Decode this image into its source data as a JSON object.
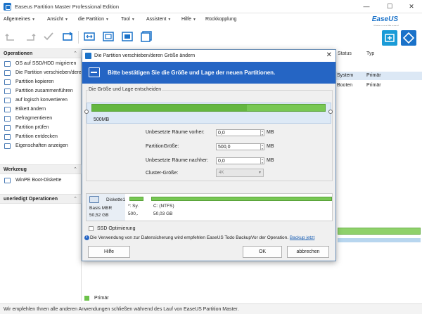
{
  "window": {
    "title": "Easeus Partition Master Professional Edition",
    "minimize": "—",
    "maximize": "☐",
    "close": "✕"
  },
  "menu": [
    {
      "label": "Allgemeines"
    },
    {
      "label": "Ansicht"
    },
    {
      "label": "die Partition"
    },
    {
      "label": "Tool"
    },
    {
      "label": "Assistent"
    },
    {
      "label": "Hilfe"
    },
    {
      "label": "Rückkopplung"
    }
  ],
  "logo": {
    "text": "EaseUS",
    "sub": "Make your life easy!"
  },
  "sidebar": {
    "operations_title": "Operationen",
    "operations": [
      "OS auf SSD/HDD migrieren",
      "Die Partition verschieben/deren Größe ändern",
      "Partition kopieren",
      "Partition zusammenführen",
      "auf logisch konvertieren",
      "Etikett ändern",
      "Defragmentieren",
      "Partition prüfen",
      "Partition entdecken",
      "Eigenschaften anzeigen"
    ],
    "tools_title": "Werkzeug",
    "tools": [
      "WinPE Boot-Diskette"
    ],
    "pending_title": "unerledigt Operationen",
    "collapse": "⌃"
  },
  "main": {
    "columns": {
      "status": "Status",
      "type": "Typ"
    },
    "rows": [
      {
        "status": "System",
        "type": "Primär"
      },
      {
        "status": "Booten",
        "type": "Primär"
      }
    ],
    "legend_label": "Primär"
  },
  "status_bar": "Wir empfehlen Ihnen alle anderen Anwendungen schließen während des Lauf von EaseUS Partition Master.",
  "dialog": {
    "title": "Die Partition verschieben/deren Größe ändern",
    "banner": "Bitte bestätigen Sie die Größe und Lage der neuen Partitionen.",
    "group_legend": "Die Größe und Lage entscheiden",
    "size_label": "500MB",
    "fields": {
      "before_label": "Unbesetzte Räume vorher:",
      "before_value": "0,0",
      "size_label": "PartitionGröße:",
      "size_value": "500,0",
      "after_label": "Unbesetzte Räume nachher:",
      "after_value": "0,0",
      "unit": "MB",
      "cluster_label": "Cluster-Größe:",
      "cluster_value": "4K"
    },
    "disk": {
      "name": "Diskette1",
      "type": "Basis MBR",
      "size": "50,52 GB",
      "part1_label": "*: Sy.",
      "part1_size": "500,.",
      "part2_label": "C: (NTFS)",
      "part2_size": "50,03 GB"
    },
    "ssd_option": "SSD Optimierung",
    "info_text": "Die Verwendung von zur Datensicherung wird empfehlen EaseUS Todo BackupVor der Operation.",
    "info_link": "Backup jetzt",
    "buttons": {
      "help": "Hilfe",
      "ok": "OK",
      "cancel": "abbrechen"
    }
  }
}
